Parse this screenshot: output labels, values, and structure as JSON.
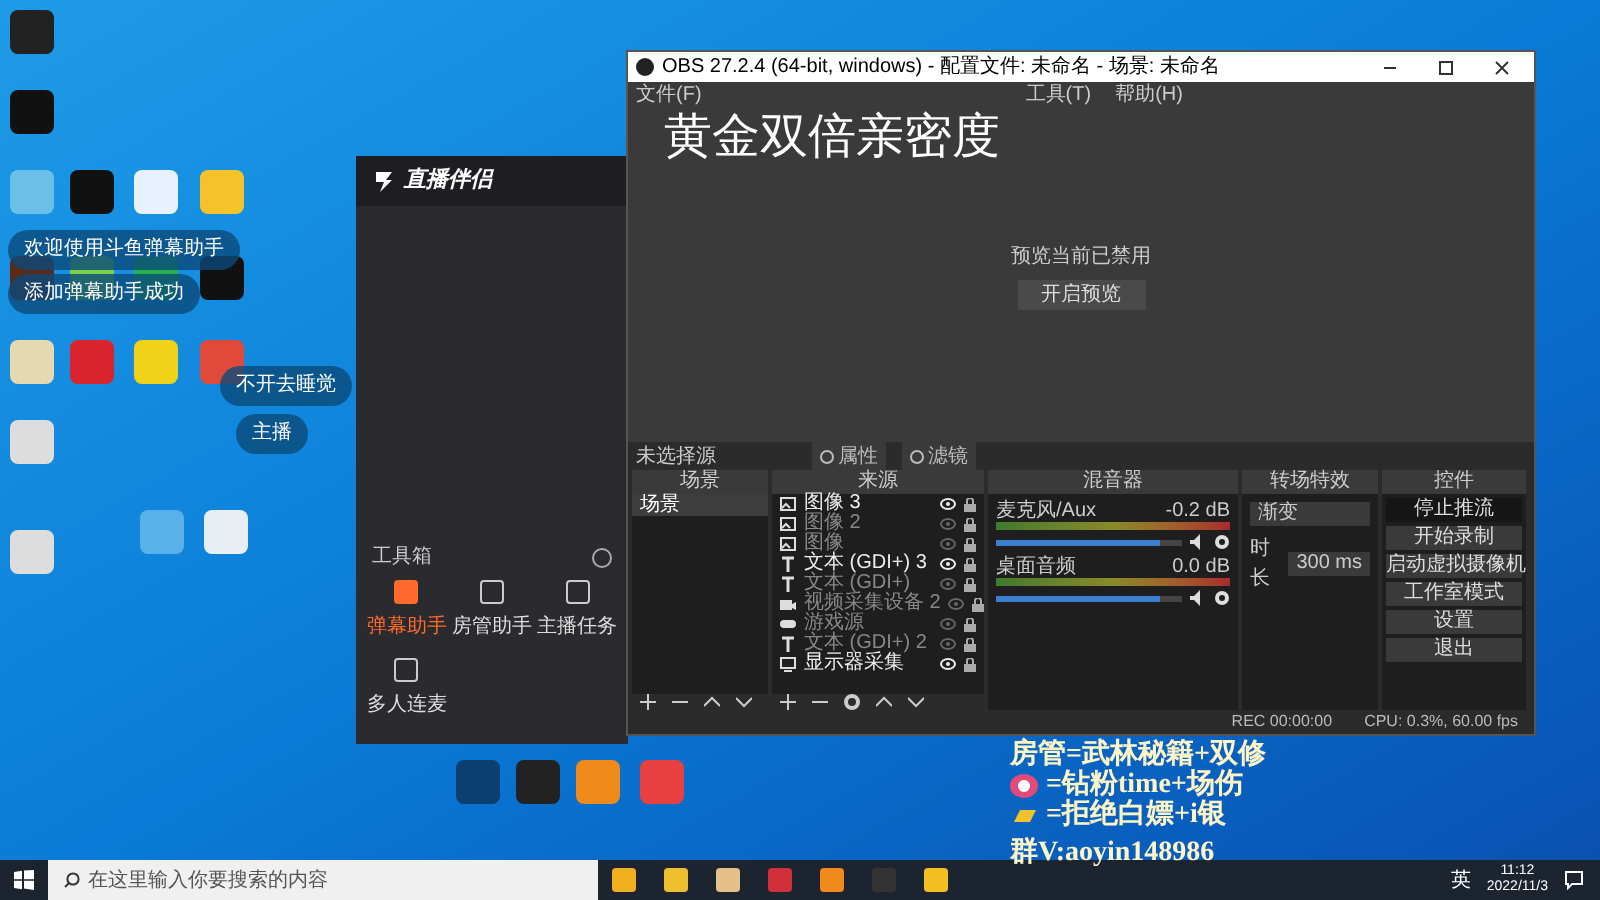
{
  "desktop_notices": [
    {
      "text": "欢迎使用斗鱼弹幕助手"
    },
    {
      "text": "添加弹幕助手成功"
    },
    {
      "text": "不开去睡觉"
    },
    {
      "text": "主播"
    }
  ],
  "companion_app": {
    "title": "直播伴侣",
    "toolbox_title": "工具箱",
    "tools": [
      {
        "label": "弹幕助手",
        "selected": true
      },
      {
        "label": "房管助手",
        "selected": false
      },
      {
        "label": "主播任务",
        "selected": false
      },
      {
        "label": "多人连麦",
        "selected": false
      }
    ]
  },
  "obs": {
    "title": "OBS 27.2.4 (64-bit, windows) - 配置文件: 未命名 - 场景: 未命名",
    "menu": [
      "文件(F)",
      "工具(T)",
      "帮助(H)"
    ],
    "overlay_title": "黄金双倍亲密度",
    "preview_message": "预览当前已禁用",
    "preview_button": "开启预览",
    "source_toolbar": {
      "status": "未选择源",
      "buttons": [
        "属性",
        "滤镜"
      ]
    },
    "scenes": {
      "title": "场景",
      "items": [
        {
          "name": "场景",
          "selected": true
        }
      ]
    },
    "sources": {
      "title": "来源",
      "items": [
        {
          "kind": "image",
          "name": "图像 3",
          "visible": true
        },
        {
          "kind": "image",
          "name": "图像 2",
          "visible": false
        },
        {
          "kind": "image",
          "name": "图像",
          "visible": false
        },
        {
          "kind": "text",
          "name": "文本 (GDI+) 3",
          "visible": true
        },
        {
          "kind": "text",
          "name": "文本 (GDI+)",
          "visible": false
        },
        {
          "kind": "camera",
          "name": "视频采集设备 2",
          "visible": false
        },
        {
          "kind": "game",
          "name": "游戏源",
          "visible": false
        },
        {
          "kind": "text",
          "name": "文本 (GDI+) 2",
          "visible": false
        },
        {
          "kind": "display",
          "name": "显示器采集",
          "visible": true
        }
      ]
    },
    "mixer": {
      "title": "混音器",
      "channels": [
        {
          "name": "麦克风/Aux",
          "reading": "-0.2 dB",
          "level": 0.88
        },
        {
          "name": "桌面音频",
          "reading": "0.0 dB",
          "level": 0.88
        }
      ]
    },
    "transitions": {
      "title": "转场特效",
      "effect": "渐变",
      "duration_label": "时长",
      "duration": "300 ms"
    },
    "controls": {
      "title": "控件",
      "buttons": [
        {
          "label": "停止推流",
          "selected": true
        },
        {
          "label": "开始录制",
          "selected": false
        },
        {
          "label": "启动虚拟摄像机",
          "selected": false
        },
        {
          "label": "工作室模式",
          "selected": false
        },
        {
          "label": "设置",
          "selected": false
        },
        {
          "label": "退出",
          "selected": false
        }
      ]
    },
    "status_bar": {
      "rec": "REC 00:00:00",
      "cpu": "CPU: 0.3%, 60.00 fps"
    }
  },
  "stream_overlay": [
    "房管=武林秘籍+双修",
    "=钻粉time+场伤",
    "=拒绝白嫖+i银",
    "群V:aoyin148986"
  ],
  "taskbar": {
    "search_placeholder": "在这里输入你要搜索的内容",
    "ime": "英",
    "time": "11:12",
    "date": "2022/11/3"
  }
}
